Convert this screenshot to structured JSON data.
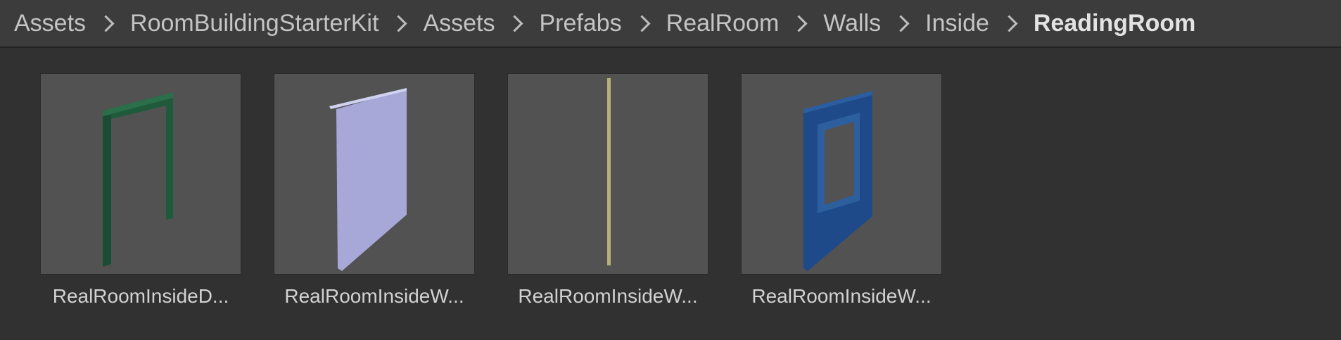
{
  "breadcrumb": {
    "items": [
      "Assets",
      "RoomBuildingStarterKit",
      "Assets",
      "Prefabs",
      "RealRoom",
      "Walls",
      "Inside",
      "ReadingRoom"
    ]
  },
  "assets": [
    {
      "label": "RealRoomInsideD...",
      "icon": "door-frame-wall-icon",
      "color": "#1f5a3a"
    },
    {
      "label": "RealRoomInsideW...",
      "icon": "plain-wall-icon",
      "color": "#a7a8d8"
    },
    {
      "label": "RealRoomInsideW...",
      "icon": "thin-wall-icon",
      "color": "#b3b07a"
    },
    {
      "label": "RealRoomInsideW...",
      "icon": "window-wall-icon",
      "color": "#1e4a8a"
    }
  ]
}
